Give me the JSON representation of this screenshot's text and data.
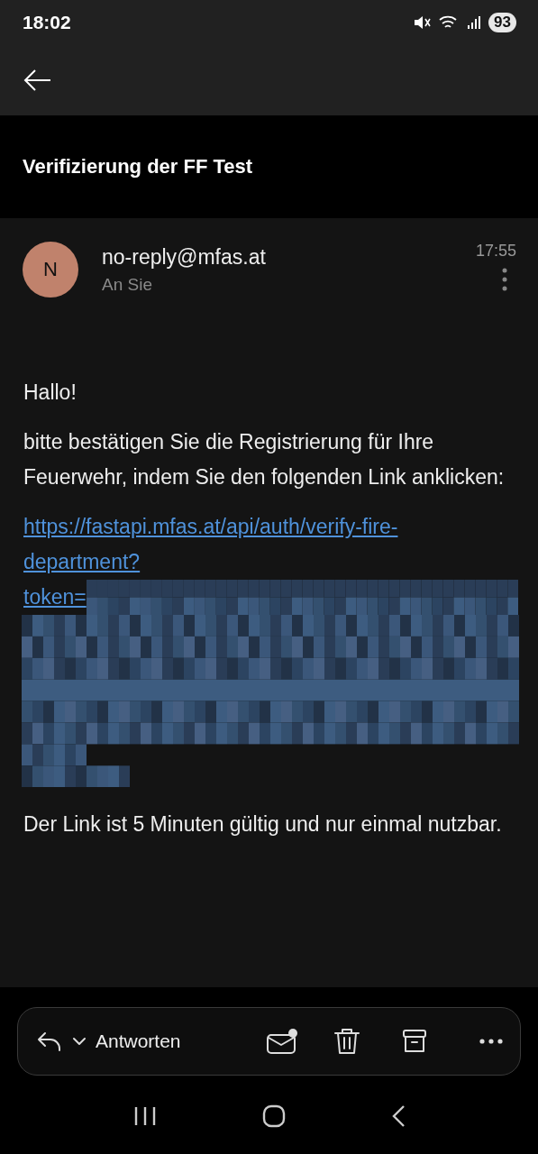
{
  "status_bar": {
    "time": "18:02",
    "battery": "93"
  },
  "subject": "Verifizierung der FF Test",
  "message": {
    "avatar_letter": "N",
    "sender": "no-reply@mfas.at",
    "recipient": "An Sie",
    "time": "17:55"
  },
  "body": {
    "greeting": "Hallo!",
    "paragraph": "bitte bestätigen Sie die Registrierung für Ihre Feuerwehr, indem Sie den folgenden Link anklicken:",
    "link": "https://fastapi.mfas.at/api/auth/verify-fire-department?",
    "link_token": "token=",
    "link_redacted": true,
    "footer": "Der Link ist 5 Minuten gültig und nur einmal nutzbar."
  },
  "toolbar": {
    "reply_label": "Antworten",
    "unread_dot": true
  }
}
